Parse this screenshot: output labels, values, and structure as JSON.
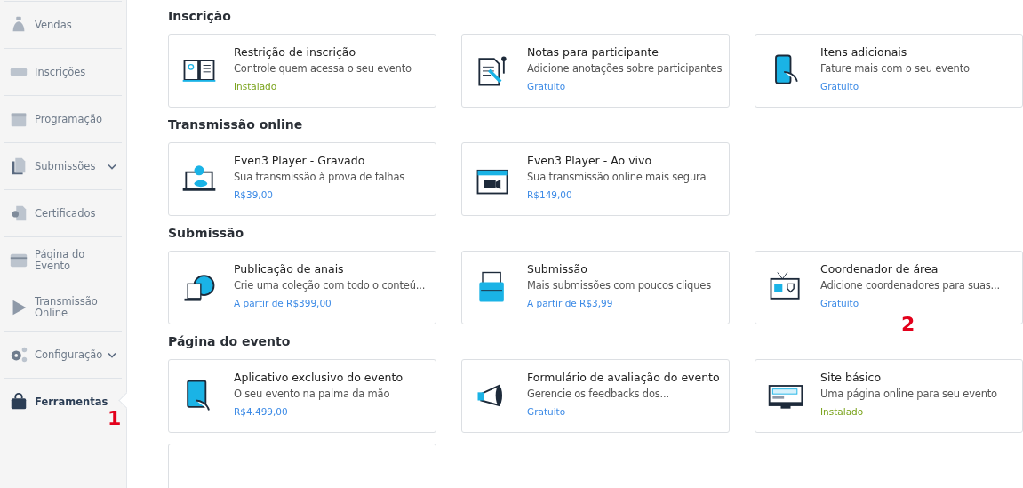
{
  "sidebar": {
    "items": [
      {
        "label": "Vendas",
        "selected": false,
        "expandable": false
      },
      {
        "label": "Inscrições",
        "selected": false,
        "expandable": false
      },
      {
        "label": "Programação",
        "selected": false,
        "expandable": false
      },
      {
        "label": "Submissões",
        "selected": false,
        "expandable": true
      },
      {
        "label": "Certificados",
        "selected": false,
        "expandable": false
      },
      {
        "label": "Página do Evento",
        "selected": false,
        "expandable": false
      },
      {
        "label": "Transmissão Online",
        "selected": false,
        "expandable": false
      },
      {
        "label": "Configuração",
        "selected": false,
        "expandable": true
      },
      {
        "label": "Ferramentas",
        "selected": true,
        "expandable": false
      }
    ]
  },
  "sections": [
    {
      "title": "Inscrição",
      "cards": [
        {
          "title": "Restrição de inscrição",
          "description": "Controle quem acessa o seu evento",
          "status": {
            "text": "Instalado",
            "kind": "installed"
          }
        },
        {
          "title": "Notas para participante",
          "description": "Adicione anotações sobre participantes",
          "status": {
            "text": "Gratuito",
            "kind": "price"
          }
        },
        {
          "title": "Itens adicionais",
          "description": "Fature mais com o seu evento",
          "status": {
            "text": "Gratuito",
            "kind": "price"
          }
        }
      ]
    },
    {
      "title": "Transmissão online",
      "cards": [
        {
          "title": "Even3 Player - Gravado",
          "description": "Sua transmissão à prova de falhas",
          "status": {
            "text": "R$39,00",
            "kind": "price"
          }
        },
        {
          "title": "Even3 Player - Ao vivo",
          "description": "Sua transmissão online mais segura",
          "status": {
            "text": "R$149,00",
            "kind": "price"
          }
        }
      ]
    },
    {
      "title": "Submissão",
      "cards": [
        {
          "title": "Publicação de anais",
          "description": "Crie uma coleção com todo o conteú...",
          "status": {
            "text": "A partir de R$399,00",
            "kind": "price"
          }
        },
        {
          "title": "Submissão",
          "description": "Mais submissões com poucos cliques",
          "status": {
            "text": "A partir de R$3,99",
            "kind": "price"
          }
        },
        {
          "title": "Coordenador de área",
          "description": "Adicione coordenadores para suas...",
          "status": {
            "text": "Gratuito",
            "kind": "price"
          }
        }
      ]
    },
    {
      "title": "Página do evento",
      "cards": [
        {
          "title": "Aplicativo exclusivo do evento",
          "description": "O seu evento na palma da mão",
          "status": {
            "text": "R$4.499,00",
            "kind": "price"
          }
        },
        {
          "title": "Formulário de avaliação do evento",
          "description": "Gerencie os feedbacks dos...",
          "status": {
            "text": "Gratuito",
            "kind": "price"
          }
        },
        {
          "title": "Site básico",
          "description": "Uma página online para seu evento",
          "status": {
            "text": "Instalado",
            "kind": "installed"
          }
        },
        {
          "kind": "partial"
        }
      ]
    }
  ],
  "annotations": [
    {
      "text": "1"
    },
    {
      "text": "2"
    }
  ]
}
